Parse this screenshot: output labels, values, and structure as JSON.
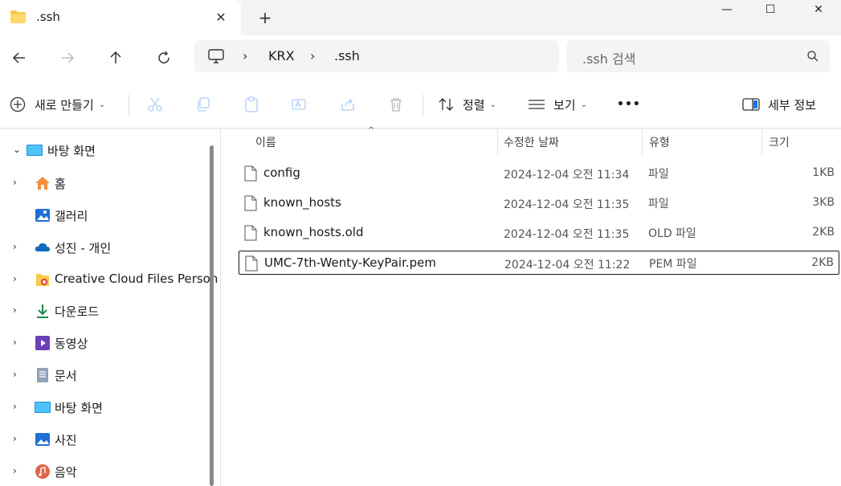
{
  "tab": {
    "title": ".ssh",
    "close": "✕",
    "new": "+"
  },
  "window_controls": {
    "minimize": "—",
    "maximize": "☐",
    "close": "✕"
  },
  "address": {
    "crumbs": [
      "KRX",
      ".ssh"
    ],
    "search_placeholder": ".ssh 검색"
  },
  "toolbar": {
    "new_label": "새로 만들기",
    "sort_label": "정렬",
    "view_label": "보기",
    "more": "•••",
    "details_label": "세부 정보"
  },
  "sidebar": {
    "items": [
      {
        "label": "바탕 화면",
        "arrow": "⌄",
        "icon": "desktop-icon"
      },
      {
        "label": "홈",
        "arrow": "›",
        "icon": "home-icon"
      },
      {
        "label": "갤러리",
        "arrow": "",
        "icon": "gallery-icon"
      },
      {
        "label": "성진 - 개인",
        "arrow": "›",
        "icon": "onedrive-icon"
      },
      {
        "label": "Creative Cloud Files Person",
        "arrow": "›",
        "icon": "creative-cloud-icon"
      },
      {
        "label": "다운로드",
        "arrow": "›",
        "icon": "download-icon"
      },
      {
        "label": "동영상",
        "arrow": "›",
        "icon": "video-icon"
      },
      {
        "label": "문서",
        "arrow": "›",
        "icon": "document-icon"
      },
      {
        "label": "바탕 화면",
        "arrow": "›",
        "icon": "desktop-icon"
      },
      {
        "label": "사진",
        "arrow": "›",
        "icon": "pictures-icon"
      },
      {
        "label": "음악",
        "arrow": "›",
        "icon": "music-icon"
      }
    ]
  },
  "columns": {
    "name": "이름",
    "date": "수정한 날짜",
    "type": "유형",
    "size": "크기"
  },
  "files": [
    {
      "name": "config",
      "date": "2024-12-04 오전 11:34",
      "type": "파일",
      "size": "1KB"
    },
    {
      "name": "known_hosts",
      "date": "2024-12-04 오전 11:35",
      "type": "파일",
      "size": "3KB"
    },
    {
      "name": "known_hosts.old",
      "date": "2024-12-04 오전 11:35",
      "type": "OLD 파일",
      "size": "2KB"
    },
    {
      "name": "UMC-7th-Wenty-KeyPair.pem",
      "date": "2024-12-04 오전 11:22",
      "type": "PEM 파일",
      "size": "2KB"
    }
  ]
}
